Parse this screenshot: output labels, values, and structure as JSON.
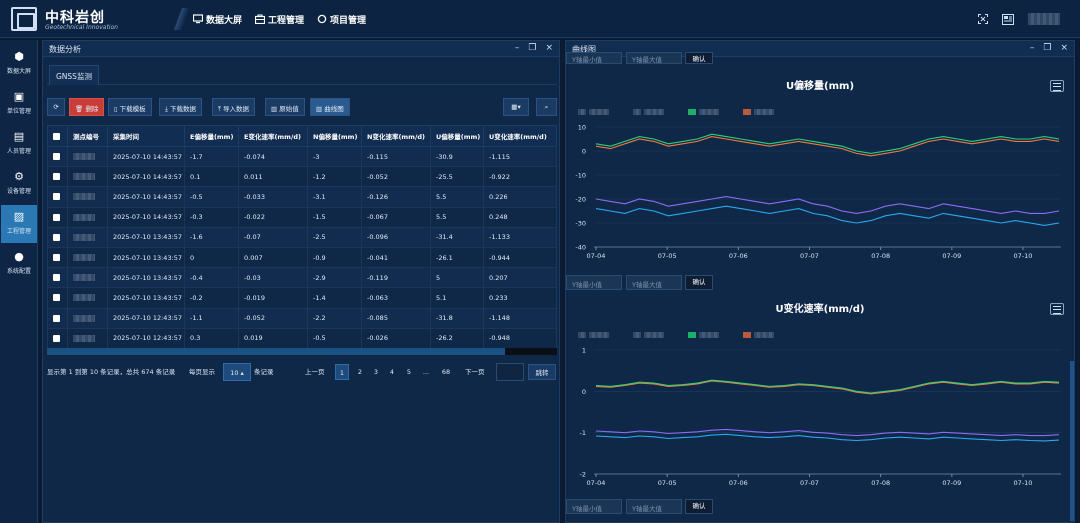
{
  "app": {
    "brand": "中科岩创",
    "brand_sub": "Geotechnical Innovation"
  },
  "topnav": [
    {
      "label": "数据大屏",
      "icon": "monitor-icon"
    },
    {
      "label": "工程管理",
      "icon": "briefcase-icon"
    },
    {
      "label": "项目管理",
      "icon": "circle-icon"
    }
  ],
  "sidebar": [
    {
      "label": "数据大屏",
      "icon": "cube-icon"
    },
    {
      "label": "单位管理",
      "icon": "calendar-icon"
    },
    {
      "label": "人员管理",
      "icon": "doc-icon"
    },
    {
      "label": "设备管理",
      "icon": "gear-icon"
    },
    {
      "label": "工程管理",
      "icon": "image-icon",
      "active": true
    },
    {
      "label": "系统配置",
      "icon": "dots-icon"
    }
  ],
  "left_panel": {
    "title": "数据分析",
    "tab": "GNSS监测",
    "toolbar": {
      "delete": "删除",
      "download_template": "下载模板",
      "download_data": "下载数据",
      "import": "导入数据",
      "raw": "原始值",
      "curve": "曲线图"
    },
    "columns": [
      "测点编号",
      "采集时间",
      "E偏移量(mm)",
      "E变化速率(mm/d)",
      "N偏移量(mm)",
      "N变化速率(mm/d)",
      "U偏移量(mm)",
      "U变化速率(mm/d)"
    ],
    "rows": [
      [
        "2025-07-10 14:43:57",
        "-1.7",
        "-0.074",
        "-3",
        "-0.115",
        "-30.9",
        "-1.115"
      ],
      [
        "2025-07-10 14:43:57",
        "0.1",
        "0.011",
        "-1.2",
        "-0.052",
        "-25.5",
        "-0.922"
      ],
      [
        "2025-07-10 14:43:57",
        "-0.5",
        "-0.033",
        "-3.1",
        "-0.126",
        "5.5",
        "0.226"
      ],
      [
        "2025-07-10 14:43:57",
        "-0.3",
        "-0.022",
        "-1.5",
        "-0.067",
        "5.5",
        "0.248"
      ],
      [
        "2025-07-10 13:43:57",
        "-1.6",
        "-0.07",
        "-2.5",
        "-0.096",
        "-31.4",
        "-1.133"
      ],
      [
        "2025-07-10 13:43:57",
        "0",
        "0.007",
        "-0.9",
        "-0.041",
        "-26.1",
        "-0.944"
      ],
      [
        "2025-07-10 13:43:57",
        "-0.4",
        "-0.03",
        "-2.9",
        "-0.119",
        "5",
        "0.207"
      ],
      [
        "2025-07-10 13:43:57",
        "-0.2",
        "-0.019",
        "-1.4",
        "-0.063",
        "5.1",
        "0.233"
      ],
      [
        "2025-07-10 12:43:57",
        "-1.1",
        "-0.052",
        "-2.2",
        "-0.085",
        "-31.8",
        "-1.148"
      ],
      [
        "2025-07-10 12:43:57",
        "0.3",
        "0.019",
        "-0.5",
        "-0.026",
        "-26.2",
        "-0.948"
      ]
    ],
    "pager": {
      "summary": "显示第 1 到第 10 条记录，总共 674 条记录",
      "per_page_prefix": "每页显示",
      "per_page": "10",
      "per_page_suffix": "条记录",
      "prev": "上一页",
      "pages": [
        "1",
        "2",
        "3",
        "4",
        "5",
        "...",
        "68"
      ],
      "next": "下一页",
      "jump": "跳转"
    }
  },
  "right_panel": {
    "title": "曲线图",
    "y_min_placeholder": "Y轴最小值",
    "y_max_placeholder": "Y轴最大值",
    "confirm": "确认"
  },
  "chart_data": [
    {
      "type": "line",
      "title": "U偏移量(mm)",
      "xlabel": "",
      "ylabel": "",
      "x_ticks": [
        "07-04",
        "07-05",
        "07-06",
        "07-07",
        "07-08",
        "07-09",
        "07-10"
      ],
      "ylim": [
        -40,
        10
      ],
      "y_ticks": [
        10,
        0,
        -10,
        -20,
        -30,
        -40
      ],
      "colors": [
        "#f07a3c",
        "#2fd07a",
        "#8b6cf5",
        "#2aa8ee"
      ],
      "series": [
        {
          "values": [
            2,
            1,
            3,
            5,
            4,
            2,
            3,
            4,
            6,
            5,
            4,
            3,
            2,
            3,
            4,
            3,
            2,
            1,
            -1,
            -2,
            -1,
            0,
            2,
            4,
            5,
            4,
            3,
            4,
            5,
            4,
            4,
            5,
            4
          ]
        },
        {
          "values": [
            3,
            2,
            4,
            6,
            5,
            3,
            4,
            5,
            7,
            6,
            5,
            4,
            3,
            4,
            5,
            4,
            3,
            2,
            0,
            -1,
            0,
            1,
            3,
            5,
            6,
            5,
            4,
            5,
            6,
            5,
            5,
            6,
            5
          ]
        },
        {
          "values": [
            -20,
            -21,
            -22,
            -20,
            -21,
            -23,
            -22,
            -21,
            -20,
            -19,
            -20,
            -21,
            -22,
            -21,
            -20,
            -22,
            -23,
            -25,
            -26,
            -25,
            -23,
            -22,
            -23,
            -24,
            -22,
            -23,
            -24,
            -25,
            -26,
            -25,
            -26,
            -26,
            -25
          ]
        },
        {
          "values": [
            -24,
            -25,
            -26,
            -24,
            -25,
            -27,
            -26,
            -25,
            -24,
            -23,
            -24,
            -25,
            -26,
            -25,
            -24,
            -26,
            -27,
            -29,
            -30,
            -29,
            -27,
            -26,
            -27,
            -28,
            -26,
            -27,
            -28,
            -29,
            -30,
            -29,
            -30,
            -31,
            -30
          ]
        }
      ]
    },
    {
      "type": "line",
      "title": "U变化速率(mm/d)",
      "xlabel": "",
      "ylabel": "",
      "x_ticks": [
        "07-04",
        "07-05",
        "07-06",
        "07-07",
        "07-08",
        "07-09",
        "07-10"
      ],
      "ylim": [
        -2,
        1
      ],
      "y_ticks": [
        1,
        0,
        -1,
        -2
      ],
      "colors": [
        "#f07a3c",
        "#2fd07a",
        "#8b6cf5",
        "#2aa8ee"
      ],
      "series": [
        {
          "values": [
            0.12,
            0.1,
            0.14,
            0.2,
            0.18,
            0.12,
            0.14,
            0.18,
            0.25,
            0.22,
            0.18,
            0.14,
            0.1,
            0.12,
            0.16,
            0.14,
            0.1,
            0.06,
            -0.02,
            -0.06,
            -0.02,
            0.02,
            0.1,
            0.18,
            0.22,
            0.18,
            0.14,
            0.18,
            0.22,
            0.18,
            0.18,
            0.22,
            0.2
          ]
        },
        {
          "values": [
            0.14,
            0.12,
            0.16,
            0.22,
            0.2,
            0.14,
            0.16,
            0.2,
            0.27,
            0.24,
            0.2,
            0.16,
            0.12,
            0.14,
            0.18,
            0.16,
            0.12,
            0.08,
            0,
            -0.04,
            0,
            0.04,
            0.12,
            0.2,
            0.24,
            0.2,
            0.16,
            0.2,
            0.24,
            0.2,
            0.2,
            0.24,
            0.22
          ]
        },
        {
          "values": [
            -0.96,
            -0.98,
            -1.0,
            -0.96,
            -0.98,
            -1.02,
            -1.0,
            -0.98,
            -0.94,
            -0.92,
            -0.95,
            -0.98,
            -1.0,
            -0.98,
            -0.95,
            -0.99,
            -1.01,
            -1.05,
            -1.07,
            -1.05,
            -1.01,
            -0.99,
            -1.01,
            -1.03,
            -0.99,
            -1.01,
            -1.03,
            -1.05,
            -1.07,
            -1.05,
            -1.07,
            -1.07,
            -1.05
          ]
        },
        {
          "values": [
            -1.08,
            -1.1,
            -1.12,
            -1.08,
            -1.1,
            -1.14,
            -1.12,
            -1.1,
            -1.06,
            -1.04,
            -1.07,
            -1.1,
            -1.12,
            -1.1,
            -1.07,
            -1.11,
            -1.13,
            -1.17,
            -1.19,
            -1.17,
            -1.13,
            -1.11,
            -1.13,
            -1.15,
            -1.11,
            -1.13,
            -1.15,
            -1.17,
            -1.19,
            -1.17,
            -1.19,
            -1.2,
            -1.18
          ]
        }
      ]
    }
  ]
}
